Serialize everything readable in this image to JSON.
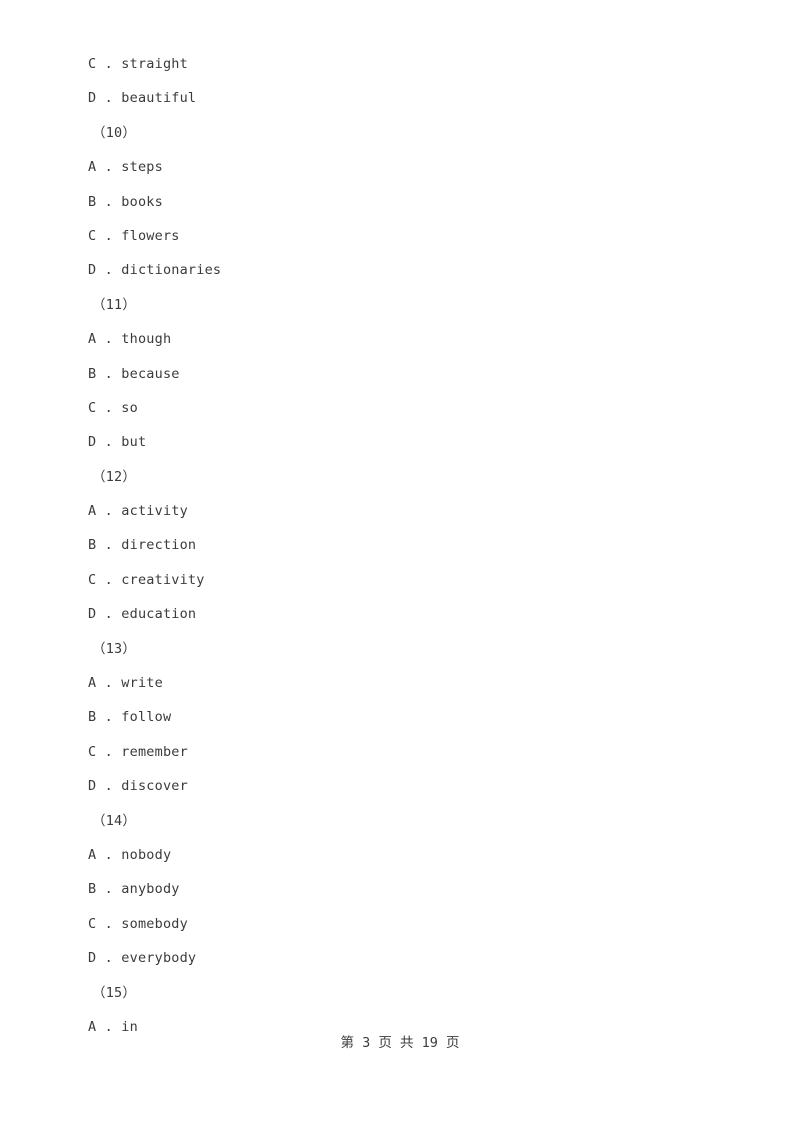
{
  "document": {
    "background_color": "#ffffff",
    "text_color": "#3b3b3b",
    "lines": [
      {
        "kind": "option",
        "text": "C . straight"
      },
      {
        "kind": "option",
        "text": "D . beautiful"
      },
      {
        "kind": "qnum",
        "text": "（10）"
      },
      {
        "kind": "option",
        "text": "A . steps"
      },
      {
        "kind": "option",
        "text": "B . books"
      },
      {
        "kind": "option",
        "text": "C . flowers"
      },
      {
        "kind": "option",
        "text": "D . dictionaries"
      },
      {
        "kind": "qnum",
        "text": "（11）"
      },
      {
        "kind": "option",
        "text": "A . though"
      },
      {
        "kind": "option",
        "text": "B . because"
      },
      {
        "kind": "option",
        "text": "C . so"
      },
      {
        "kind": "option",
        "text": "D . but"
      },
      {
        "kind": "qnum",
        "text": "（12）"
      },
      {
        "kind": "option",
        "text": "A . activity"
      },
      {
        "kind": "option",
        "text": "B . direction"
      },
      {
        "kind": "option",
        "text": "C . creativity"
      },
      {
        "kind": "option",
        "text": "D . education"
      },
      {
        "kind": "qnum",
        "text": "（13）"
      },
      {
        "kind": "option",
        "text": "A . write"
      },
      {
        "kind": "option",
        "text": "B . follow"
      },
      {
        "kind": "option",
        "text": "C . remember"
      },
      {
        "kind": "option",
        "text": "D . discover"
      },
      {
        "kind": "qnum",
        "text": "（14）"
      },
      {
        "kind": "option",
        "text": "A . nobody"
      },
      {
        "kind": "option",
        "text": "B . anybody"
      },
      {
        "kind": "option",
        "text": "C . somebody"
      },
      {
        "kind": "option",
        "text": "D . everybody"
      },
      {
        "kind": "qnum",
        "text": "（15）"
      },
      {
        "kind": "option",
        "text": "A . in"
      }
    ]
  },
  "footer": {
    "page_label": "第 3 页 共 19 页",
    "current_page": 3,
    "total_pages": 19
  }
}
